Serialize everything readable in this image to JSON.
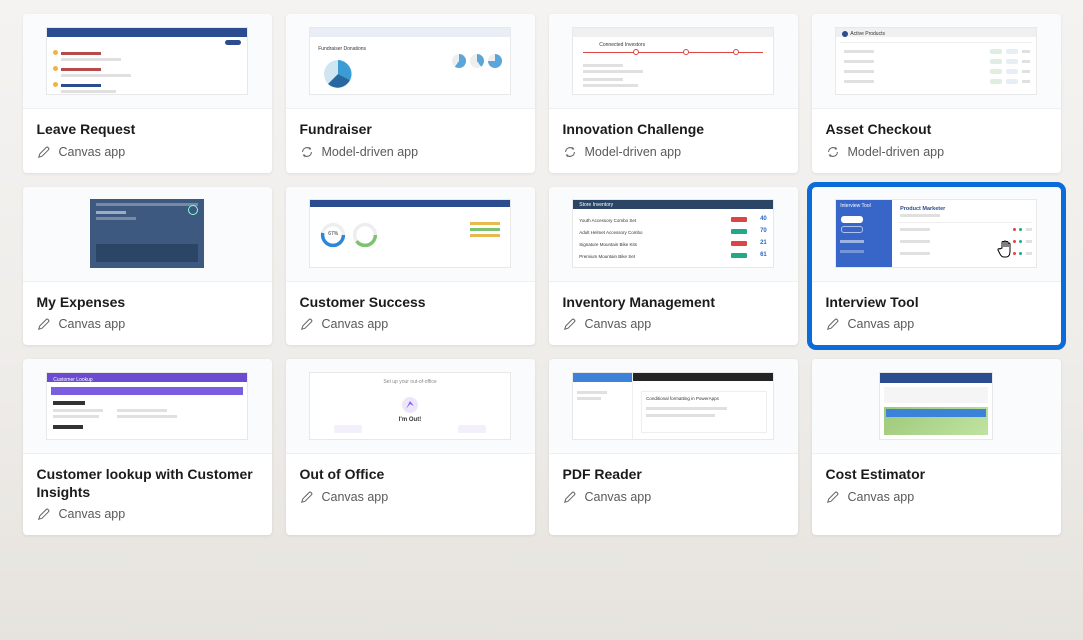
{
  "cards": [
    {
      "title": "Leave Request",
      "type": "Canvas app",
      "icon": "pencil",
      "selected": false,
      "thumb": "leave"
    },
    {
      "title": "Fundraiser",
      "type": "Model-driven app",
      "icon": "refresh",
      "selected": false,
      "thumb": "fund"
    },
    {
      "title": "Innovation Challenge",
      "type": "Model-driven app",
      "icon": "refresh",
      "selected": false,
      "thumb": "innov"
    },
    {
      "title": "Asset Checkout",
      "type": "Model-driven app",
      "icon": "refresh",
      "selected": false,
      "thumb": "asset"
    },
    {
      "title": "My Expenses",
      "type": "Canvas app",
      "icon": "pencil",
      "selected": false,
      "thumb": "exp"
    },
    {
      "title": "Customer Success",
      "type": "Canvas app",
      "icon": "pencil",
      "selected": false,
      "thumb": "cust"
    },
    {
      "title": "Inventory Management",
      "type": "Canvas app",
      "icon": "pencil",
      "selected": false,
      "thumb": "inv"
    },
    {
      "title": "Interview Tool",
      "type": "Canvas app",
      "icon": "pencil",
      "selected": true,
      "thumb": "intv",
      "cursor": true
    },
    {
      "title": "Customer lookup with Customer Insights",
      "type": "Canvas app",
      "icon": "pencil",
      "selected": false,
      "thumb": "look"
    },
    {
      "title": "Out of Office",
      "type": "Canvas app",
      "icon": "pencil",
      "selected": false,
      "thumb": "ooo"
    },
    {
      "title": "PDF Reader",
      "type": "Canvas app",
      "icon": "pencil",
      "selected": false,
      "thumb": "pdf"
    },
    {
      "title": "Cost Estimator",
      "type": "Canvas app",
      "icon": "pencil",
      "selected": false,
      "thumb": "cost"
    }
  ],
  "thumb_text": {
    "inv_title": "Store Inventory",
    "inv_rows": [
      {
        "label": "Youth Accessory Combo Set",
        "chip": "red",
        "num": "40"
      },
      {
        "label": "Adult Helmet Accessory Combo",
        "chip": "green",
        "num": "70"
      },
      {
        "label": "Signature Mountain Bike Kits",
        "chip": "red",
        "num": "21"
      },
      {
        "label": "Premium Mountain Bike Set",
        "chip": "green",
        "num": "61"
      }
    ],
    "intv_header": "Interview Tool",
    "intv_role": "Product Marketer",
    "ooo_text": "I'm Out!"
  }
}
